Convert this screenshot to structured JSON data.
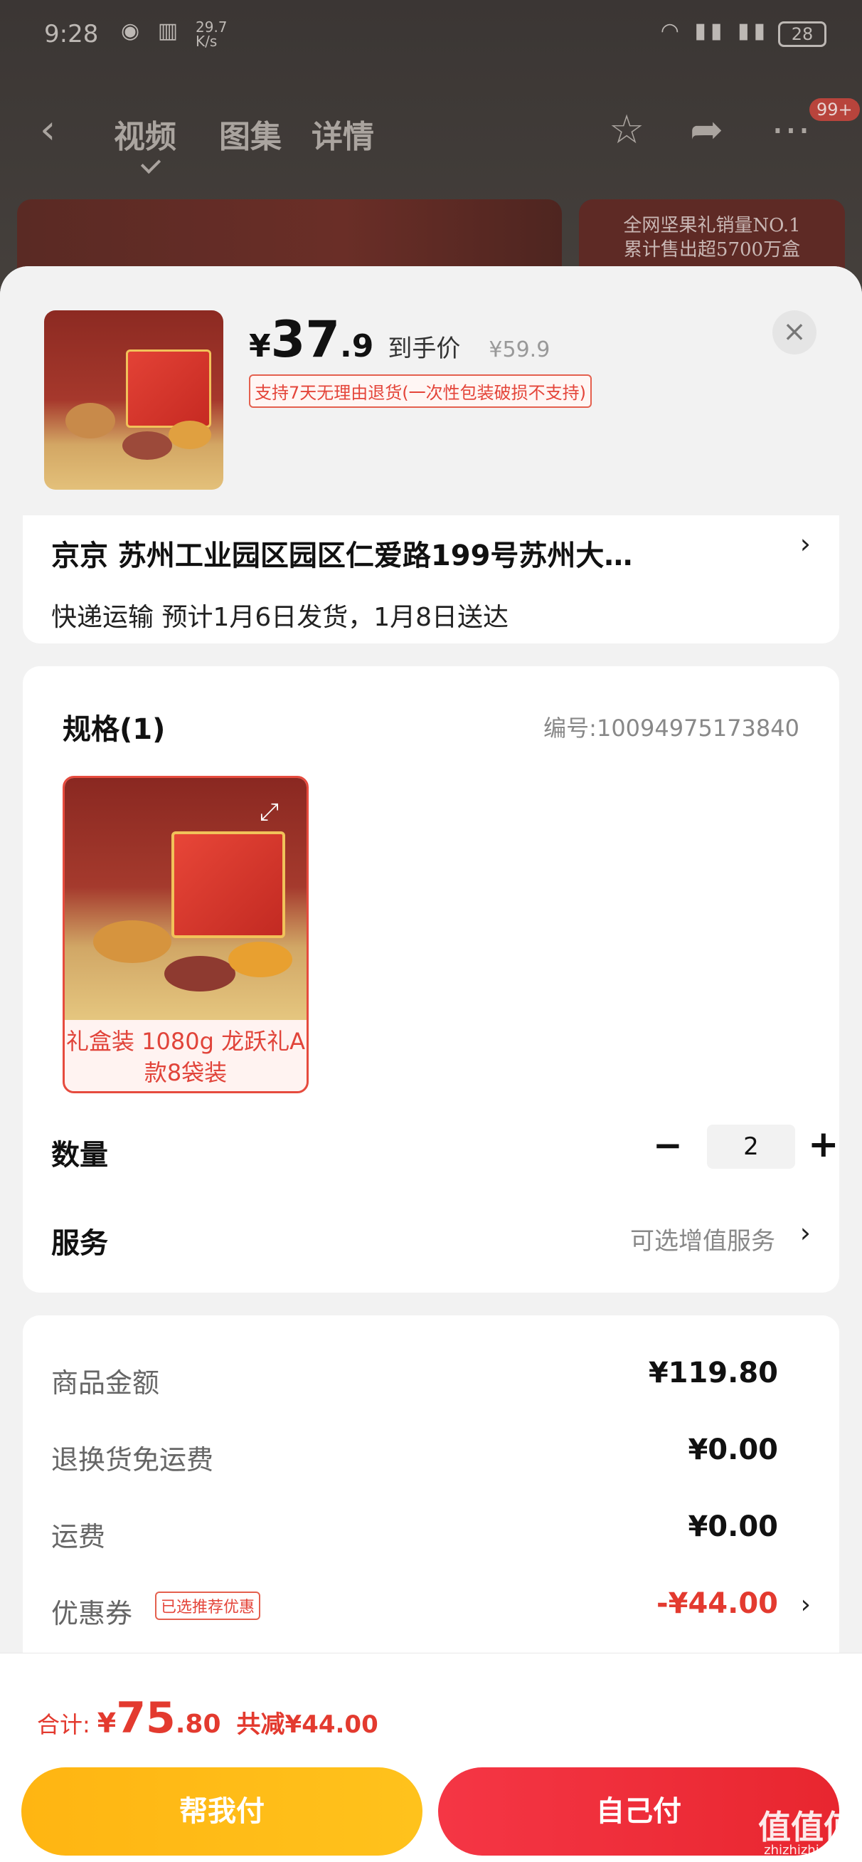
{
  "status_bar": {
    "time": "9:28",
    "speed_value": "29.7",
    "speed_unit": "K/s",
    "battery": "28"
  },
  "nav": {
    "tabs": [
      "视频",
      "图集",
      "详情"
    ],
    "badge": "99+"
  },
  "banner": {
    "line1": "全网坚果礼销量NO.1",
    "line2": "累计售出超5700万盒"
  },
  "product": {
    "price_yen": "¥",
    "price_int": "37",
    "price_dec": ".9",
    "price_tag": "到手价",
    "original_price": "¥59.9",
    "return_policy": "支持7天无理由退货(一次性包装破损不支持)"
  },
  "address": {
    "text": "京京   苏州工业园区园区仁爱路199号苏州大…",
    "shipping": "快递运输  预计1月6日发货，1月8日送达"
  },
  "spec": {
    "title": "规格(1)",
    "code": "编号:10094975173840",
    "option_label": "礼盒装 1080g 龙跃礼A款8袋装"
  },
  "quantity": {
    "label": "数量",
    "value": "2",
    "minus": "−",
    "plus": "+"
  },
  "service": {
    "label": "服务",
    "hint": "可选增值服务"
  },
  "summary": {
    "goods_label": "商品金额",
    "goods_value": "¥119.80",
    "return_ship_label": "退换货免运费",
    "return_ship_value": "¥0.00",
    "shipping_label": "运费",
    "shipping_value": "¥0.00",
    "coupon_label": "优惠券",
    "coupon_tag": "已选推荐优惠",
    "coupon_value": "-¥44.00"
  },
  "total": {
    "label": "合计:",
    "yen": "¥",
    "int": "75",
    "dec": ".80",
    "saved": "共减¥44.00"
  },
  "buttons": {
    "help_pay": "帮我付",
    "self_pay": "自己付"
  },
  "watermark": {
    "main": "值值值",
    "sub": "zhizhizhi.com"
  },
  "colors": {
    "accent_red": "#e33a2f",
    "button_yellow": "#ffb512",
    "button_red": "#f53645"
  }
}
